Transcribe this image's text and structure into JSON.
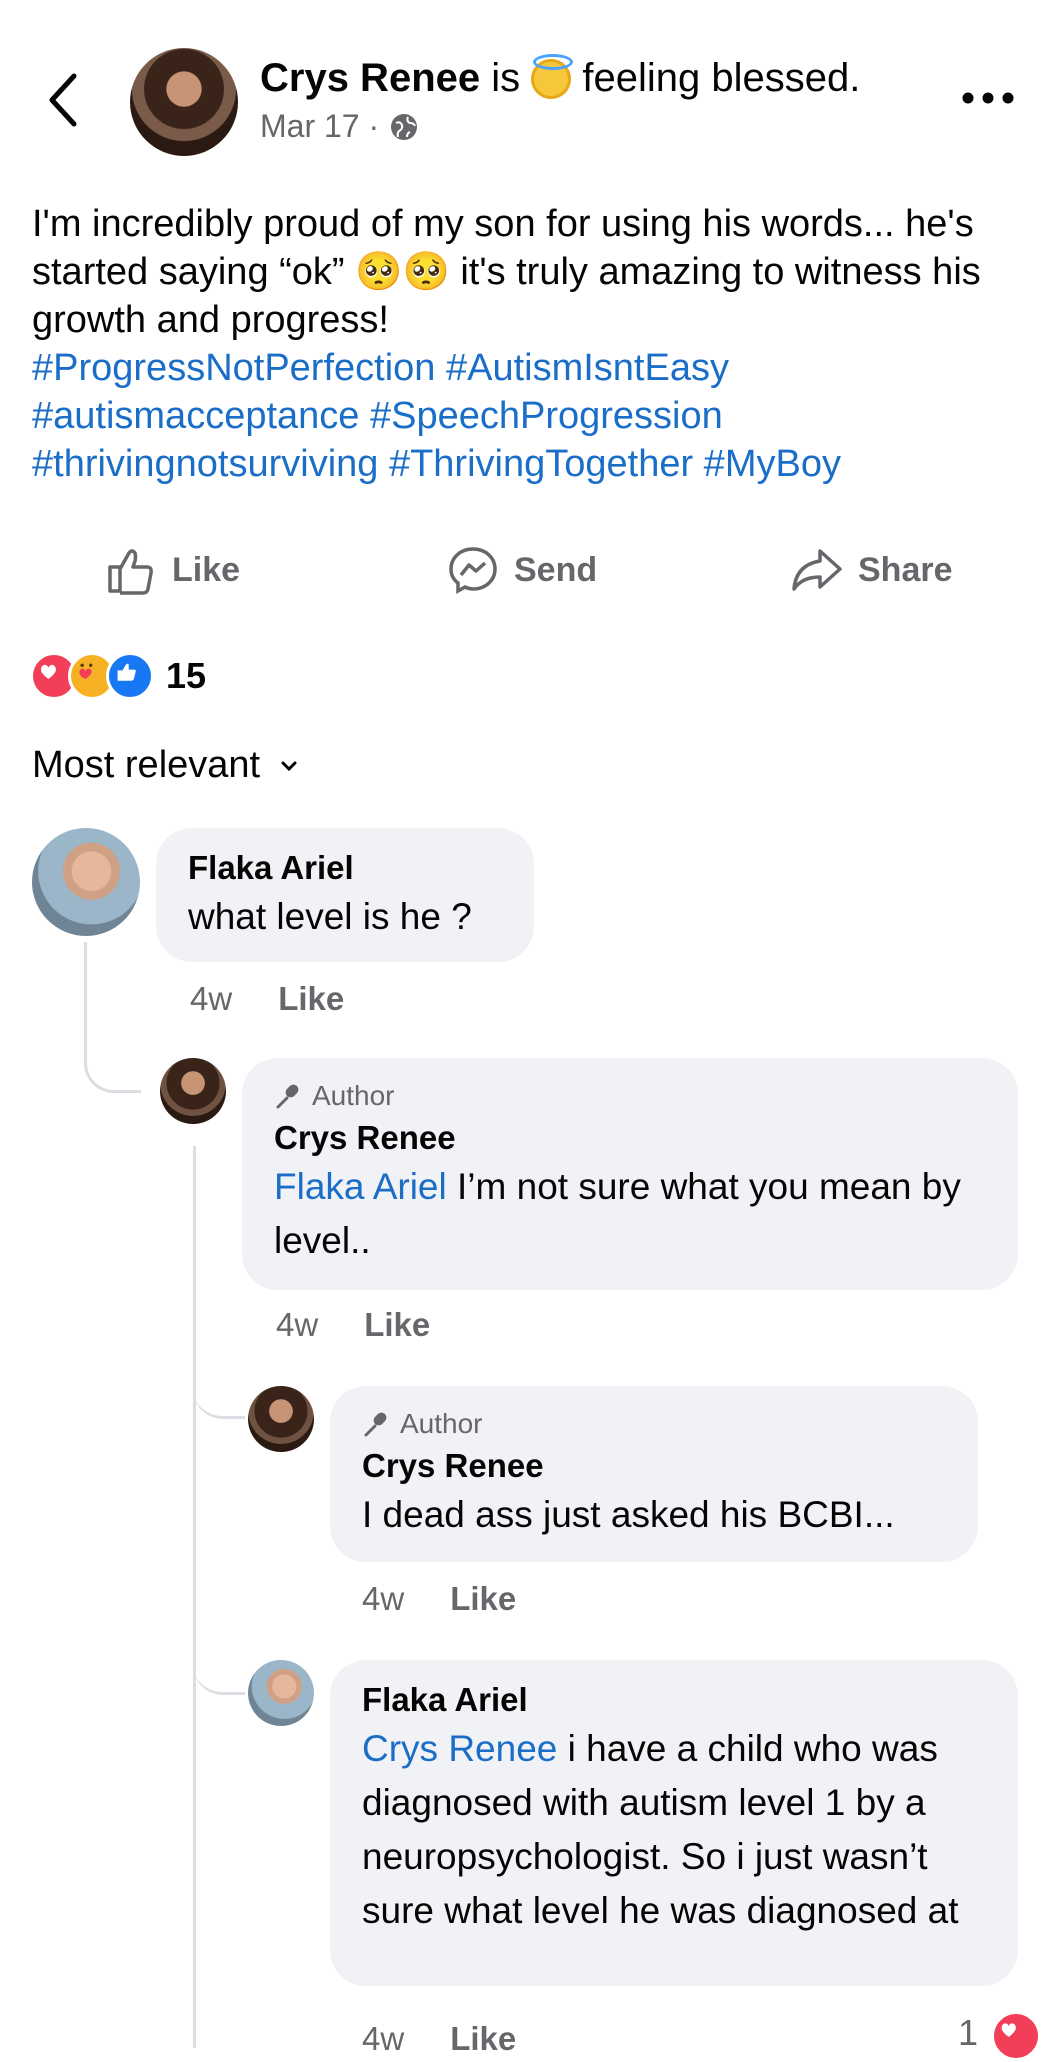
{
  "header": {
    "author": "Crys Renee",
    "is": "is",
    "feeling": "feeling blessed.",
    "date": "Mar 17",
    "separator": "·"
  },
  "post": {
    "text": "I'm incredibly proud of my son for using his words... he's started saying “ok” 🥺🥺 it's truly amazing to witness his growth and progress!",
    "hashtags": "#ProgressNotPerfection #AutismIsntEasy #autismacceptance #SpeechProgression #thrivingnotsurviving #ThrivingTogether #MyBoy"
  },
  "actions": {
    "like": "Like",
    "send": "Send",
    "share": "Share"
  },
  "reactions": {
    "count": "15",
    "types": [
      "love",
      "care",
      "like"
    ]
  },
  "sort": {
    "label": "Most relevant"
  },
  "comments": [
    {
      "name": "Flaka Ariel",
      "text": "what level is he ?",
      "time": "4w",
      "like": "Like"
    },
    {
      "badge": "Author",
      "name": "Crys Renee",
      "mention": "Flaka Ariel",
      "text": " I’m not sure what you mean by level..",
      "time": "4w",
      "like": "Like"
    },
    {
      "badge": "Author",
      "name": "Crys Renee",
      "text": "I dead ass just asked his BCBI...",
      "time": "4w",
      "like": "Like"
    },
    {
      "name": "Flaka Ariel",
      "mention": "Crys Renee",
      "text": " i have a child who was diagnosed with autism level 1 by a neuropsychologist. So i just wasn’t sure what level he was diagnosed at",
      "time": "4w",
      "like": "Like",
      "reaction_count": "1"
    }
  ],
  "colors": {
    "link": "#1a6ec8",
    "muted": "#65676b",
    "bubble": "#f0f2f5"
  }
}
